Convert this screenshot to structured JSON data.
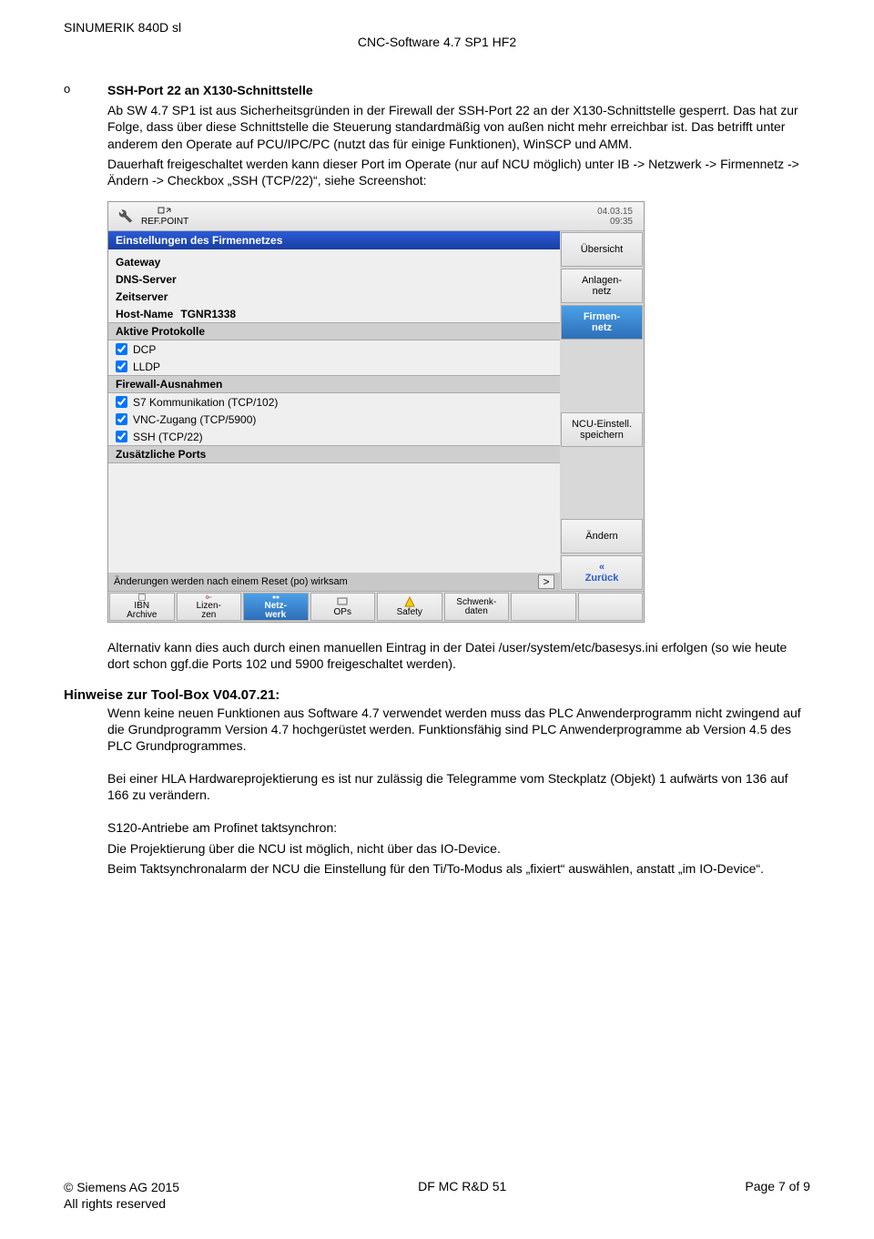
{
  "header": {
    "left": "SINUMERIK 840D sl",
    "center": "CNC-Software 4.7 SP1 HF2"
  },
  "bullet": {
    "sym": "o",
    "title": "SSH-Port 22 an X130-Schnittstelle",
    "p1": "Ab SW 4.7 SP1 ist aus Sicherheitsgründen in der Firewall der SSH-Port 22 an der X130-Schnittstelle gesperrt. Das hat zur Folge, dass über diese Schnittstelle die Steuerung standardmäßig von außen nicht mehr erreichbar ist. Das betrifft unter anderem den Operate auf PCU/IPC/PC (nutzt das für einige Funktionen), WinSCP und AMM.",
    "p2": "Dauerhaft freigeschaltet werden kann dieser Port im Operate (nur auf NCU möglich)  unter IB -> Netzwerk -> Firmennetz -> Ändern -> Checkbox „SSH (TCP/22)“, siehe Screenshot:"
  },
  "shot": {
    "refpoint": "REF.POINT",
    "date": "04.03.15",
    "time": "09:35",
    "title": "Einstellungen des Firmennetzes",
    "rows": {
      "gateway": "Gateway",
      "dns": "DNS-Server",
      "time": "Zeitserver",
      "host": "Host-Name",
      "hostval": "TGNR1338"
    },
    "sec1": "Aktive Protokolle",
    "chk1": "DCP",
    "chk2": "LLDP",
    "sec2": "Firewall-Ausnahmen",
    "chk3": "S7 Kommunikation (TCP/102)",
    "chk4": "VNC-Zugang (TCP/5900)",
    "chk5": "SSH (TCP/22)",
    "sec3": "Zusätzliche Ports",
    "reset_note": "Änderungen werden nach einem Reset (po) wirksam",
    "rbuttons": [
      "Übersicht",
      "Anlagen-\nnetz",
      "Firmen-\nnetz",
      "NCU-Einstell.\nspeichern",
      "Ändern",
      "«\nZurück"
    ],
    "bbuttons": [
      "IBN\nArchive",
      "Lizen-\nzen",
      "Netz-\nwerk",
      "OPs",
      "Safety",
      "Schwenk-\ndaten"
    ]
  },
  "after1": "Alternativ kann dies auch durch einen manuellen Eintrag in der Datei /user/system/etc/basesys.ini erfolgen (so wie heute dort schon ggf.die Ports 102 und 5900 freigeschaltet werden).",
  "toolbox": {
    "title": "Hinweise zur Tool-Box V04.07.21:",
    "p1": "Wenn keine neuen Funktionen aus Software 4.7 verwendet werden muss das PLC Anwenderprogramm nicht zwingend auf die Grundprogramm Version 4.7 hochgerüstet werden. Funktionsfähig sind PLC Anwenderprogramme ab Version 4.5 des PLC Grundprogrammes.",
    "p2": "Bei einer HLA Hardwareprojektierung es ist nur zulässig die Telegramme vom Steckplatz (Objekt) 1 aufwärts von 136 auf 166 zu verändern.",
    "p3": "S120-Antriebe am Profinet taktsynchron:",
    "p4": "Die Projektierung über die NCU ist möglich, nicht über das IO-Device.",
    "p5": "Beim Taktsynchronalarm der NCU die Einstellung für den Ti/To-Modus als „fixiert“ auswählen, anstatt „im IO-Device“."
  },
  "footer": {
    "left1": "© Siemens AG 2015",
    "left2": "All rights reserved",
    "center": "DF MC R&D 51",
    "right": "Page 7 of 9"
  }
}
